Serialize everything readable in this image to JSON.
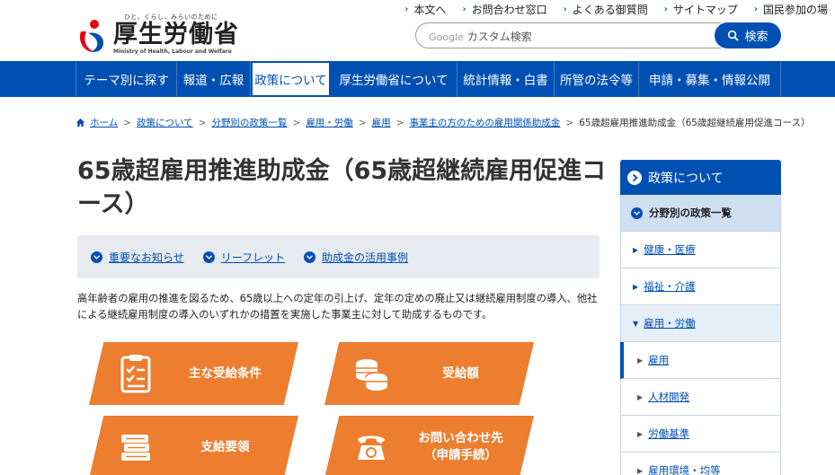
{
  "header": {
    "tagline": "ひと、くらし、みらいのために",
    "logo_name": "厚生労働省",
    "logo_en": "Ministry of Health, Labour and Welfare",
    "utility_links": [
      "本文へ",
      "お問合わせ窓口",
      "よくある御質問",
      "サイトマップ",
      "国民参加の場"
    ],
    "search_brand": "Google",
    "search_placeholder": "カスタム検索",
    "search_button": "検索"
  },
  "gnav": {
    "items": [
      "テーマ別に探す",
      "報道・広報",
      "政策について",
      "厚生労働省について",
      "統計情報・白書",
      "所管の法令等",
      "申請・募集・情報公開"
    ],
    "active": "政策について"
  },
  "breadcrumb": {
    "items": [
      "ホーム",
      "政策について",
      "分野別の政策一覧",
      "雇用・労働",
      "雇用",
      "事業主の方のための雇用関係助成金"
    ],
    "current": "65歳超雇用推進助成金（65歳超継続雇用促進コース）"
  },
  "main": {
    "title": "65歳超雇用推進助成金（65歳超継続雇用促進コース）",
    "anchors": [
      "重要なお知らせ",
      "リーフレット",
      "助成金の活用事例"
    ],
    "intro": "高年齢者の雇用の推進を図るため、65歳以上への定年の引上げ、定年の定めの廃止又は継続雇用制度の導入、他社による継続雇用制度の導入のいずれかの措置を実施した事業主に対して助成するものです。",
    "tiles": [
      {
        "label": "主な受給条件",
        "icon": "checklist-icon"
      },
      {
        "label": "受給額",
        "icon": "coins-icon"
      },
      {
        "label": "支給要領",
        "icon": "books-icon"
      },
      {
        "label": "お問い合わせ先\n（申請手続）",
        "icon": "telephone-icon"
      }
    ],
    "accent_color": "#ed7d2f"
  },
  "sidenav": {
    "heading": "政策について",
    "level1": "分野別の政策一覧",
    "items": [
      {
        "label": "健康・医療",
        "level": 2
      },
      {
        "label": "福祉・介護",
        "level": 2
      },
      {
        "label": "雇用・労働",
        "level": 2,
        "open": true
      },
      {
        "label": "雇用",
        "level": 3,
        "current": true
      },
      {
        "label": "人材開発",
        "level": 3
      },
      {
        "label": "労働基準",
        "level": 3
      },
      {
        "label": "雇用環境・均等",
        "level": 3
      }
    ]
  },
  "colors": {
    "brand_blue": "#0050b3",
    "logo_red": "#e60012",
    "logo_blue": "#0050b3"
  }
}
